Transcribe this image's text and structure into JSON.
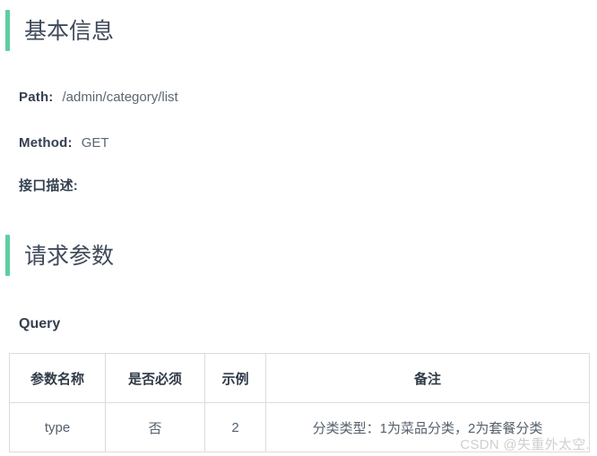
{
  "sections": [
    {
      "id": "basic",
      "title": "基本信息",
      "accent_color": "#5ecfa0"
    },
    {
      "id": "params",
      "title": "请求参数",
      "accent_color": "#5ecfa0"
    }
  ],
  "basic_info": {
    "path": {
      "label": "Path:",
      "value": "/admin/category/list"
    },
    "method": {
      "label": "Method:",
      "value": "GET"
    },
    "description": {
      "label": "接口描述:",
      "value": ""
    }
  },
  "request_params": {
    "subheading": "Query",
    "table": {
      "headers": [
        "参数名称",
        "是否必须",
        "示例",
        "备注"
      ],
      "rows": [
        {
          "name": "type",
          "required": "否",
          "example": "2",
          "remark": "分类类型：1为菜品分类，2为套餐分类"
        }
      ]
    }
  },
  "watermark": "CSDN @失重外太空."
}
